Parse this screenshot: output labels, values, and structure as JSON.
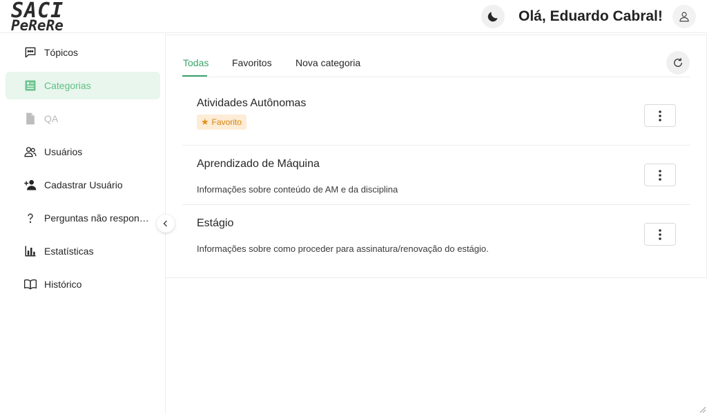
{
  "header": {
    "logo_line1": "SACI",
    "logo_line2": "PeReRe",
    "greeting": "Olá, Eduardo Cabral!",
    "theme_icon": "moon-icon",
    "avatar_icon": "user-icon"
  },
  "sidebar": {
    "items": [
      {
        "label": "Tópicos",
        "icon": "chat-icon",
        "state": "normal"
      },
      {
        "label": "Categorias",
        "icon": "list-icon",
        "state": "active"
      },
      {
        "label": "QA",
        "icon": "file-icon",
        "state": "disabled"
      },
      {
        "label": "Usuários",
        "icon": "users-icon",
        "state": "normal"
      },
      {
        "label": "Cadastrar Usuário",
        "icon": "user-add-icon",
        "state": "normal"
      },
      {
        "label": "Perguntas não respondidas",
        "icon": "question-icon",
        "state": "normal"
      },
      {
        "label": "Estatísticas",
        "icon": "bar-chart-icon",
        "state": "normal"
      },
      {
        "label": "Histórico",
        "icon": "book-icon",
        "state": "normal"
      }
    ],
    "collapse_icon": "chevron-left-icon"
  },
  "main": {
    "tabs": [
      {
        "label": "Todas",
        "active": true
      },
      {
        "label": "Favoritos",
        "active": false
      },
      {
        "label": "Nova categoria",
        "active": false
      }
    ],
    "refresh_icon": "refresh-icon",
    "categories": [
      {
        "title": "Atividades Autônomas",
        "favorite": true,
        "favorite_label": "Favorito",
        "description": ""
      },
      {
        "title": "Aprendizado de Máquina",
        "favorite": false,
        "description": "Informações sobre conteúdo de AM e da disciplina"
      },
      {
        "title": "Estágio",
        "favorite": false,
        "description": "Informações sobre como proceder para assinatura/renovação do estágio."
      }
    ]
  },
  "colors": {
    "accent": "#3aa36a",
    "active_bg": "#e8f6ee",
    "favorite_bg": "#fdecd6",
    "favorite_text": "#d4840e"
  }
}
